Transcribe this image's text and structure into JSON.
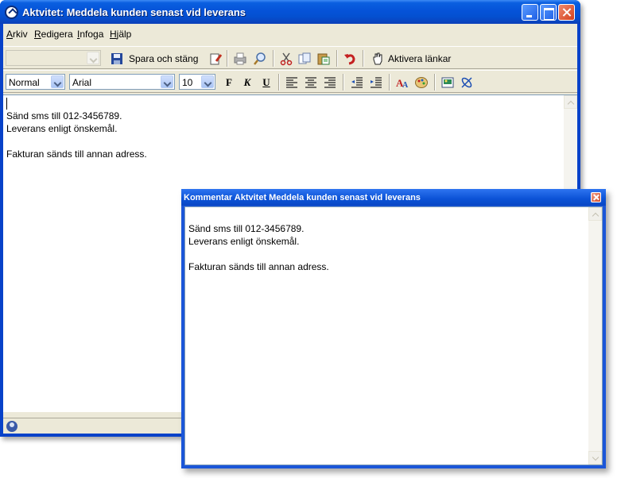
{
  "main_window": {
    "title": "Aktvitet: Meddela kunden senast vid leverans"
  },
  "menu": {
    "items": [
      {
        "accel": "A",
        "rest": "rkiv"
      },
      {
        "accel": "R",
        "rest": "edigera"
      },
      {
        "accel": "I",
        "rest": "nfoga"
      },
      {
        "accel": "H",
        "rest": "jälp"
      }
    ]
  },
  "toolbar": {
    "save_close_label": "Spara och stäng",
    "activate_links_label": "Aktivera länkar",
    "style_value": "Normal",
    "font_value": "Arial",
    "size_value": "10",
    "bold_glyph": "F",
    "italic_glyph": "K",
    "underline_glyph": "U"
  },
  "editor": {
    "text": "Sänd sms till 012-3456789.\nLeverans enligt önskemål.\n\nFakturan sänds till annan adress."
  },
  "comment_window": {
    "title": "Kommentar Aktvitet Meddela kunden senast vid leverans",
    "text": "Sänd sms till 012-3456789.\nLeverans enligt önskemål.\n\nFakturan sänds till annan adress."
  },
  "colors": {
    "title_bar": "#0553d8",
    "window_face": "#ece9d8",
    "close_button": "#d3411f"
  },
  "icons": [
    "app-icon",
    "save-icon",
    "edit-icon",
    "print-icon",
    "zoom-icon",
    "cut-icon",
    "copy-icon",
    "paste-icon",
    "undo-icon",
    "hand-icon",
    "align-left-icon",
    "align-center-icon",
    "align-right-icon",
    "outdent-icon",
    "indent-icon",
    "text-color-icon",
    "palette-icon",
    "image-icon",
    "link-icon",
    "status-icon"
  ]
}
